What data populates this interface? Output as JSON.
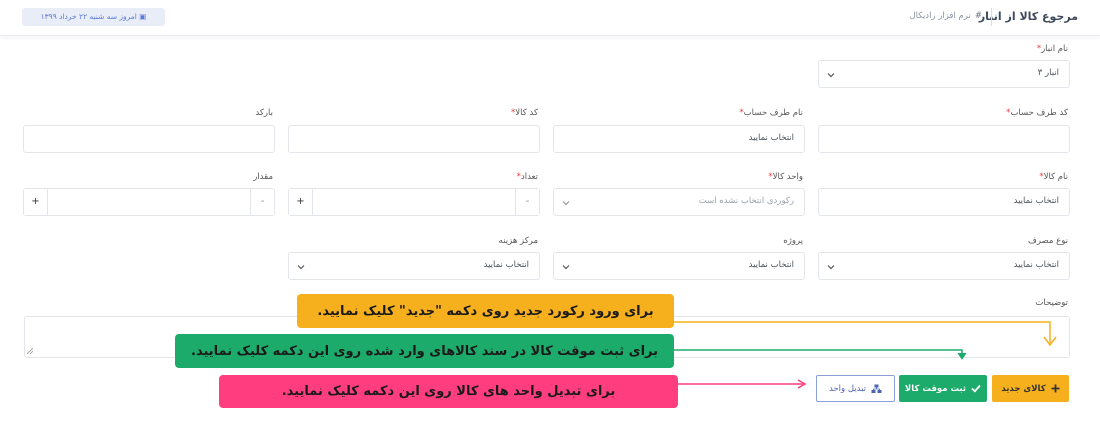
{
  "header": {
    "page_title": "مرجوع کالا از انبار",
    "breadcrumb_hash": "#",
    "breadcrumb": "نرم افزار رادیکال",
    "date": "امروز سه شنبه ۲۲ خرداد ۱۳۹۹"
  },
  "form": {
    "warehouse": {
      "label": "نام انبار",
      "required": "*",
      "value": "انبار ۳"
    },
    "account_code": {
      "label": "کد طرف حساب",
      "required": "*",
      "value": ""
    },
    "account_name": {
      "label": "نام طرف حساب",
      "required": "*",
      "value": "انتخاب نمایید"
    },
    "product_code": {
      "label": "کد کالا",
      "required": "*",
      "value": ""
    },
    "barcode": {
      "label": "بارکد",
      "value": ""
    },
    "product_name": {
      "label": "نام کالا",
      "required": "*",
      "value": "انتخاب نمایید"
    },
    "unit": {
      "label": "واحد کالا",
      "required": "*",
      "placeholder": "رکوردی انتخاب نشده است"
    },
    "count": {
      "label": "تعداد",
      "required": "*",
      "minus": "-",
      "plus": "+"
    },
    "amount": {
      "label": "مقدار",
      "minus": "-",
      "plus": "+"
    },
    "usage_type": {
      "label": "نوع مصرف",
      "value": "انتخاب نمایید"
    },
    "project": {
      "label": "پروژه",
      "value": "انتخاب نمایید"
    },
    "cost_center": {
      "label": "مرکز هزینه",
      "value": "انتخاب نمایید"
    },
    "description": {
      "label": "توضیحات"
    }
  },
  "buttons": {
    "new_item": "کالای جدید",
    "temp_save": "ثبت موقت کالا",
    "convert_unit": "تبدیل واحد"
  },
  "tooltips": {
    "new": "برای ورود رکورد جدید روی دکمه \"جدید\" کلیک نمایید.",
    "save": "برای ثبت موقت کالا در سند کالاهای وارد شده روی این دکمه کلیک نمایید.",
    "convert": "برای تبدیل واحد های کالا روی این دکمه کلیک نمایید."
  },
  "colors": {
    "accent_yellow": "#f6b01e",
    "accent_green": "#1dab6b",
    "accent_pink": "#ff3d7f",
    "accent_blue": "#4a63b5"
  },
  "icons": {
    "chevron": "chevron-down-icon",
    "plus": "plus-icon",
    "check": "check-icon",
    "convert": "convert-icon",
    "calendar": "calendar-icon"
  }
}
